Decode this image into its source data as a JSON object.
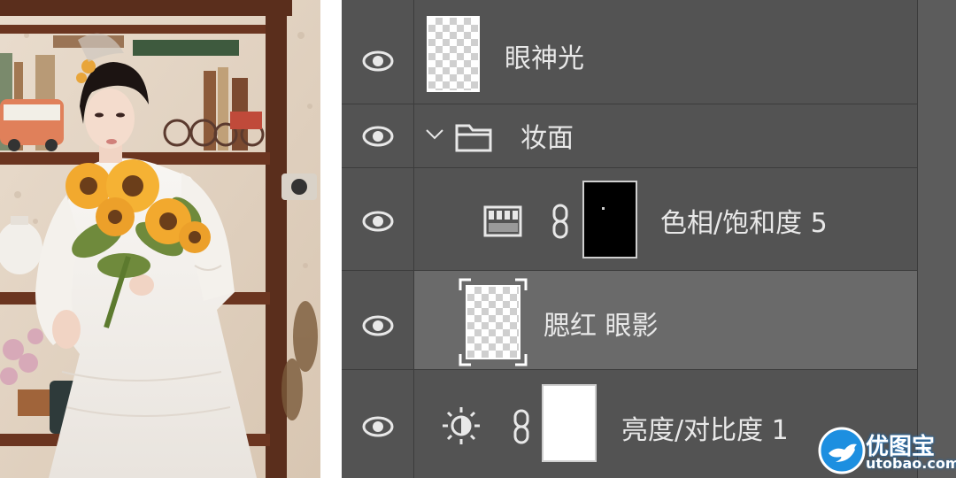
{
  "colors": {
    "panel_bg": "#535353",
    "row_selected_bg": "#6a6a6a",
    "divider": "#3c3c3c",
    "text": "#e8e8e8",
    "watermark_blue": "#1d8fe0"
  },
  "photo": {
    "icon": "portrait-photo"
  },
  "layers": [
    {
      "name": "眼神光",
      "type": "pixel",
      "thumbnail": "transparent",
      "visible": true,
      "selected": false
    },
    {
      "name": "妆面",
      "type": "group",
      "collapse_icon": "chevron-down-icon",
      "folder_icon": "folder-icon",
      "visible": true,
      "selected": false
    },
    {
      "name": "色相/饱和度 5",
      "type": "adjustment",
      "adjustment_icon": "hue-saturation-icon",
      "link_icon": "chain-link-icon",
      "mask": "black",
      "visible": true,
      "selected": false
    },
    {
      "name": "腮红 眼影",
      "type": "pixel",
      "thumbnail": "transparent",
      "visible": true,
      "selected": true
    },
    {
      "name": "亮度/对比度 1",
      "type": "adjustment",
      "adjustment_icon": "brightness-contrast-icon",
      "link_icon": "chain-link-icon",
      "mask": "white",
      "visible": true,
      "selected": false
    }
  ],
  "watermark": {
    "logo_icon": "bird-logo-icon",
    "text_cn": "优图宝",
    "text_url": "utobao.com"
  }
}
